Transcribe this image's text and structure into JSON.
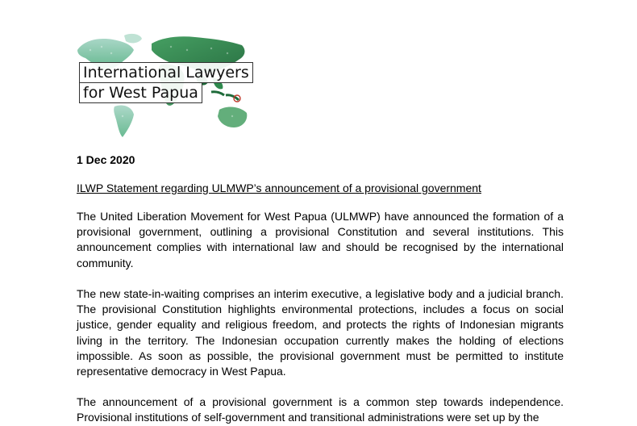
{
  "logo": {
    "line1": "International Lawyers",
    "line2": "for West Papua",
    "colors": {
      "dark_green": "#1f6b3a",
      "mid_green": "#3c9a5a",
      "light_teal": "#9fd2c0"
    }
  },
  "date": "1 Dec 2020",
  "subject": "ILWP Statement regarding ULMWP’s announcement of a provisional government",
  "paragraphs": [
    "The United Liberation Movement for West Papua (ULMWP) have announced the formation of a provisional government, outlining a provisional Constitution and several institutions. This announcement complies with international law and should be recognised by the international community.",
    "The new state-in-waiting comprises an interim executive, a legislative body and a judicial branch. The provisional Constitution highlights environmental protections, includes a focus on social justice, gender equality and religious freedom, and protects the rights of Indonesian migrants living in the territory. The Indonesian occupation currently makes the holding of elections impossible. As soon as possible, the provisional government must be permitted to institute representative democracy in West Papua.",
    "The announcement of a provisional government is a common step towards independence. Provisional institutions of self-government and transitional administrations were set up by the"
  ]
}
